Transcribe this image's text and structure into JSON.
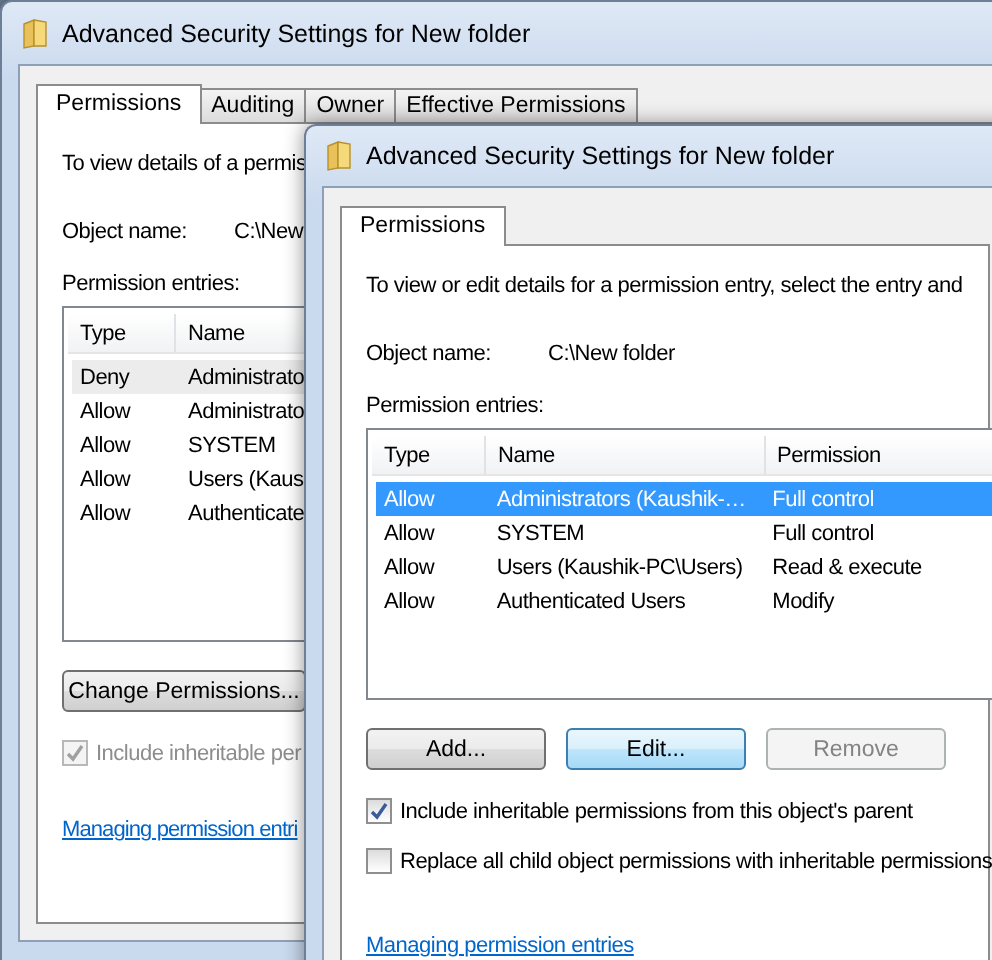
{
  "back_window": {
    "title": "Advanced Security Settings for New folder",
    "tabs": [
      {
        "label": "Permissions",
        "selected": true
      },
      {
        "label": "Auditing",
        "selected": false
      },
      {
        "label": "Owner",
        "selected": false
      },
      {
        "label": "Effective Permissions",
        "selected": false
      }
    ],
    "intro": "To view details of a permis",
    "object_name_label": "Object name:",
    "object_name_value": "C:\\New",
    "entries_label": "Permission entries:",
    "columns": [
      "Type",
      "Name"
    ],
    "rows": [
      {
        "cells": [
          "Deny",
          "Administrato"
        ],
        "selected": true
      },
      {
        "cells": [
          "Allow",
          "Administrato"
        ],
        "selected": false
      },
      {
        "cells": [
          "Allow",
          "SYSTEM"
        ],
        "selected": false
      },
      {
        "cells": [
          "Allow",
          "Users (Kaus"
        ],
        "selected": false
      },
      {
        "cells": [
          "Allow",
          "Authenticate"
        ],
        "selected": false
      }
    ],
    "buttons": [
      {
        "label": "Change Permissions...",
        "focused": false,
        "disabled": false
      }
    ],
    "checkboxes": [
      {
        "label": "Include inheritable per",
        "checked": true,
        "disabled": true
      }
    ],
    "help_link": "Managing permission entri"
  },
  "front_window": {
    "title": "Advanced Security Settings for New folder",
    "tabs": [
      {
        "label": "Permissions",
        "selected": true
      }
    ],
    "intro": "To view or edit details for a permission entry, select the entry and",
    "object_name_label": "Object name:",
    "object_name_value": "C:\\New folder",
    "entries_label": "Permission entries:",
    "columns": [
      "Type",
      "Name",
      "Permission"
    ],
    "rows": [
      {
        "cells": [
          "Allow",
          "Administrators (Kaushik-…",
          "Full control"
        ],
        "selected": true
      },
      {
        "cells": [
          "Allow",
          "SYSTEM",
          "Full control"
        ],
        "selected": false
      },
      {
        "cells": [
          "Allow",
          "Users (Kaushik-PC\\Users)",
          "Read & execute"
        ],
        "selected": false
      },
      {
        "cells": [
          "Allow",
          "Authenticated Users",
          "Modify"
        ],
        "selected": false
      }
    ],
    "buttons": [
      {
        "label": "Add...",
        "focused": false,
        "disabled": false
      },
      {
        "label": "Edit...",
        "focused": true,
        "disabled": false
      },
      {
        "label": "Remove",
        "focused": false,
        "disabled": true
      }
    ],
    "checkboxes": [
      {
        "label": "Include inheritable permissions from this object's parent",
        "checked": true,
        "disabled": false
      },
      {
        "label": "Replace all child object permissions with inheritable permissions",
        "checked": false,
        "disabled": false
      }
    ],
    "help_link": "Managing permission entries"
  }
}
